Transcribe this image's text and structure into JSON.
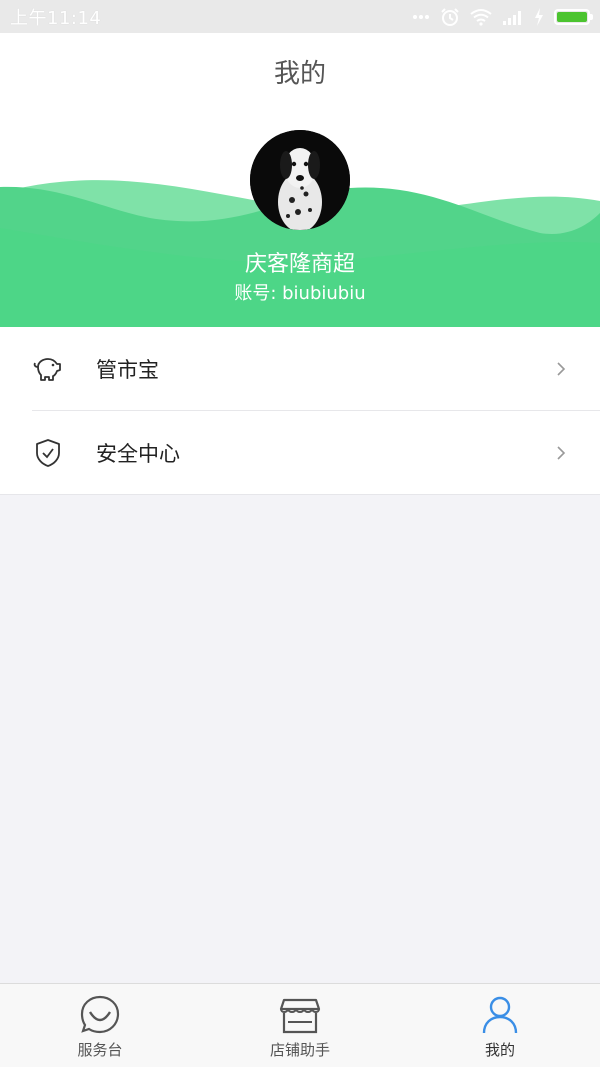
{
  "status_bar": {
    "time": "上午11:14",
    "icons": [
      "more-dots-icon",
      "alarm-icon",
      "wifi-icon",
      "signal-icon",
      "charging-icon",
      "battery-icon"
    ],
    "battery_color": "#4cc430"
  },
  "header": {
    "title": "我的",
    "store_name": "庆客隆商超",
    "account": "账号: biubiubiu",
    "wave_color": "#4dd687",
    "wave_light_color": "#7fe2a8"
  },
  "menu": {
    "items": [
      {
        "label": "管市宝",
        "icon": "piggy-bank-icon"
      },
      {
        "label": "安全中心",
        "icon": "shield-check-icon"
      }
    ]
  },
  "tabbar": {
    "items": [
      {
        "label": "服务台",
        "icon": "smile-chat-icon",
        "active": false
      },
      {
        "label": "店铺助手",
        "icon": "storefront-icon",
        "active": false
      },
      {
        "label": "我的",
        "icon": "user-icon",
        "active": true
      }
    ],
    "active_color": "#3a8ee6"
  }
}
